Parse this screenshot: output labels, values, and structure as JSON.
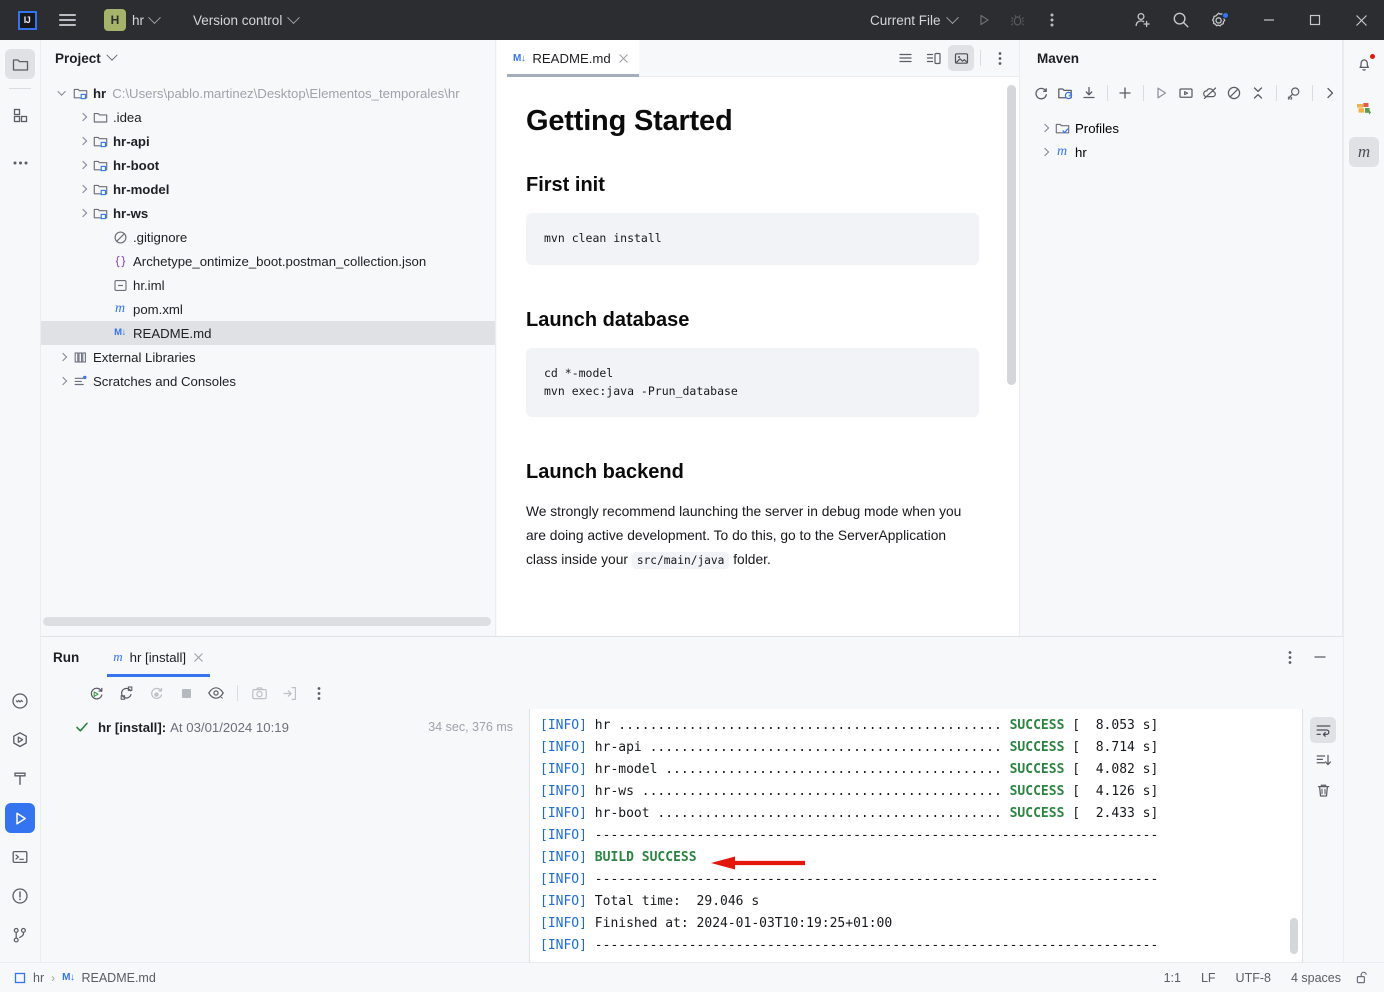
{
  "titlebar": {
    "app_logo": "intellij-idea-logo",
    "logo_text": "IJ",
    "menu_icon": "hamburger-menu-icon",
    "project_badge": "H",
    "project_name": "hr",
    "version_control": "Version control",
    "run_config": "Current File",
    "run_icon": "run-icon",
    "debug_icon": "debug-icon",
    "more_icon": "more-actions-icon",
    "share_icon": "add-user-icon",
    "search_icon": "search-icon",
    "settings_icon": "settings-gear-icon",
    "minimize": "minimize-icon",
    "maximize": "maximize-icon",
    "close": "close-icon"
  },
  "left_toolbar": [
    {
      "name": "project-tool-window",
      "icon": "folder-icon",
      "selected": true
    },
    {
      "name": "structure-tool-window",
      "icon": "modules-icon",
      "selected": false
    },
    {
      "name": "more-tool-windows",
      "icon": "ellipsis-icon",
      "selected": false
    }
  ],
  "left_toolbar_bottom": [
    {
      "name": "commit-tool-window",
      "icon": "commit-icon",
      "selected": false
    },
    {
      "name": "services-tool-window",
      "icon": "services-icon",
      "selected": false
    },
    {
      "name": "build-tool-window",
      "icon": "hammer-icon",
      "selected": false
    },
    {
      "name": "run-tool-window",
      "icon": "run-play-icon",
      "selected": true
    },
    {
      "name": "terminal-tool-window",
      "icon": "terminal-icon",
      "selected": false
    },
    {
      "name": "problems-tool-window",
      "icon": "warning-circle-icon",
      "selected": false
    },
    {
      "name": "git-tool-window",
      "icon": "git-branch-icon",
      "selected": false
    }
  ],
  "right_toolbar": [
    {
      "name": "notifications",
      "icon": "bell-icon",
      "badge": true
    },
    {
      "name": "database-tool-window",
      "icon": "database-icon",
      "badge": false
    },
    {
      "name": "maven-tool-window",
      "icon": "maven-m-icon",
      "selected": true
    }
  ],
  "project_panel": {
    "title": "Project",
    "tree": [
      {
        "label": "hr",
        "path": "C:\\Users\\pablo.martinez\\Desktop\\Elementos_temporales\\hr",
        "icon": "module-folder-icon",
        "indent": 0,
        "twisty": "down",
        "bold": true
      },
      {
        "label": ".idea",
        "icon": "folder-icon",
        "indent": 1,
        "twisty": "right",
        "bold": false
      },
      {
        "label": "hr-api",
        "icon": "module-folder-icon",
        "indent": 1,
        "twisty": "right",
        "bold": true
      },
      {
        "label": "hr-boot",
        "icon": "module-folder-icon",
        "indent": 1,
        "twisty": "right",
        "bold": true
      },
      {
        "label": "hr-model",
        "icon": "module-folder-icon",
        "indent": 1,
        "twisty": "right",
        "bold": true
      },
      {
        "label": "hr-ws",
        "icon": "module-folder-icon",
        "indent": 1,
        "twisty": "right",
        "bold": true
      },
      {
        "label": ".gitignore",
        "icon": "gitignore-icon",
        "indent": 2,
        "twisty": "none",
        "bold": false
      },
      {
        "label": "Archetype_ontimize_boot.postman_collection.json",
        "icon": "json-icon",
        "indent": 2,
        "twisty": "none",
        "bold": false
      },
      {
        "label": "hr.iml",
        "icon": "iml-icon",
        "indent": 2,
        "twisty": "none",
        "bold": false
      },
      {
        "label": "pom.xml",
        "icon": "maven-m-icon",
        "indent": 2,
        "twisty": "none",
        "bold": false
      },
      {
        "label": "README.md",
        "icon": "markdown-icon",
        "indent": 2,
        "twisty": "none",
        "bold": false,
        "selected": true
      },
      {
        "label": "External Libraries",
        "icon": "libraries-icon",
        "indent": 0,
        "twisty": "right",
        "bold": false
      },
      {
        "label": "Scratches and Consoles",
        "icon": "scratches-icon",
        "indent": 0,
        "twisty": "right",
        "bold": false
      }
    ]
  },
  "editor": {
    "tab": {
      "label": "README.md",
      "icon": "markdown-icon",
      "close": "close-icon"
    },
    "view_buttons": [
      {
        "name": "editor-only-view",
        "icon": "lines-icon",
        "active": false
      },
      {
        "name": "editor-and-preview-view",
        "icon": "split-view-icon",
        "active": false
      },
      {
        "name": "preview-only-view",
        "icon": "image-preview-icon",
        "active": true
      }
    ],
    "more_icon": "more-options-icon",
    "markdown": {
      "h1": "Getting Started",
      "section1_title": "First init",
      "section1_code": "mvn clean install",
      "section2_title": "Launch database",
      "section2_code": "cd *-model\nmvn exec:java -Prun_database",
      "section3_title": "Launch backend",
      "section3_text_a": "We strongly recommend launching the server in debug mode when you are doing active development. To do this, go to the ServerApplication class inside your ",
      "section3_code_inline": "src/main/java",
      "section3_text_b": " folder."
    }
  },
  "maven_panel": {
    "title": "Maven",
    "toolbar": [
      {
        "name": "reload-all-maven-projects-button",
        "icon": "refresh-icon"
      },
      {
        "name": "generate-sources-button",
        "icon": "folder-refresh-icon"
      },
      {
        "name": "download-sources-button",
        "icon": "download-icon"
      },
      {
        "name": "add-maven-project-button",
        "icon": "plus-icon"
      },
      {
        "name": "run-maven-build-button",
        "icon": "run-icon"
      },
      {
        "name": "execute-maven-goal-button",
        "icon": "terminal-run-icon"
      },
      {
        "name": "toggle-offline-mode-button",
        "icon": "offline-cloud-icon"
      },
      {
        "name": "toggle-skip-tests-button",
        "icon": "skip-tests-icon"
      },
      {
        "name": "collapse-all-button",
        "icon": "collapse-icon"
      },
      {
        "name": "show-dependencies-button",
        "icon": "analyze-dependencies-icon"
      },
      {
        "name": "expand-toolbar-button",
        "icon": "chevron-right-icon"
      }
    ],
    "tree": [
      {
        "label": "Profiles",
        "icon": "profiles-folder-icon",
        "twisty": "right"
      },
      {
        "label": "hr",
        "icon": "maven-m-icon",
        "twisty": "right"
      }
    ]
  },
  "run_panel": {
    "title": "Run",
    "tab": {
      "label": "hr [install]",
      "icon": "maven-m-icon",
      "close": "close-icon"
    },
    "options_icon": "more-options-icon",
    "minimize_icon": "minimize-panel-icon",
    "toolbar": [
      {
        "name": "rerun-button",
        "icon": "rerun-icon"
      },
      {
        "name": "rerun-failed-button",
        "icon": "rerun-failed-icon"
      },
      {
        "name": "rerun-automatically-button",
        "icon": "rerun-auto-icon"
      },
      {
        "name": "stop-button",
        "icon": "stop-square-icon"
      },
      {
        "name": "show-passed-button",
        "icon": "eye-icon"
      },
      {
        "name": "export-snapshot-button",
        "icon": "camera-icon"
      },
      {
        "name": "import-results-button",
        "icon": "import-icon"
      },
      {
        "name": "more-run-options",
        "icon": "more-options-icon"
      }
    ],
    "result_item": {
      "status_icon": "checkmark-icon",
      "name": "hr [install]:",
      "timestamp": "At 03/01/2024 10:19",
      "duration": "34 sec, 376 ms"
    },
    "console_gutter": [
      {
        "name": "soft-wrap-button",
        "icon": "soft-wrap-icon",
        "active": true
      },
      {
        "name": "scroll-to-end-button",
        "icon": "scroll-to-end-icon",
        "active": false
      },
      {
        "name": "clear-all-button",
        "icon": "trash-icon",
        "active": false
      }
    ],
    "console_lines": [
      {
        "prefix": "[INFO]",
        "text": " hr ................................................. ",
        "status": "SUCCESS",
        "time": "[  8.053 s]"
      },
      {
        "prefix": "[INFO]",
        "text": " hr-api ............................................. ",
        "status": "SUCCESS",
        "time": "[  8.714 s]"
      },
      {
        "prefix": "[INFO]",
        "text": " hr-model ........................................... ",
        "status": "SUCCESS",
        "time": "[  4.082 s]"
      },
      {
        "prefix": "[INFO]",
        "text": " hr-ws .............................................. ",
        "status": "SUCCESS",
        "time": "[  4.126 s]"
      },
      {
        "prefix": "[INFO]",
        "text": " hr-boot ............................................ ",
        "status": "SUCCESS",
        "time": "[  2.433 s]"
      },
      {
        "prefix": "[INFO]",
        "text": " ------------------------------------------------------------------------",
        "status": "",
        "time": ""
      },
      {
        "prefix": "[INFO]",
        "text": " ",
        "status": "BUILD SUCCESS",
        "time": ""
      },
      {
        "prefix": "[INFO]",
        "text": " ------------------------------------------------------------------------",
        "status": "",
        "time": ""
      },
      {
        "prefix": "[INFO]",
        "text": " Total time:  29.046 s",
        "status": "",
        "time": ""
      },
      {
        "prefix": "[INFO]",
        "text": " Finished at: 2024-01-03T10:19:25+01:00",
        "status": "",
        "time": ""
      },
      {
        "prefix": "[INFO]",
        "text": " ------------------------------------------------------------------------",
        "status": "",
        "time": ""
      }
    ],
    "annotation": {
      "type": "red-arrow",
      "color": "#e3170a",
      "points_to": "BUILD SUCCESS"
    }
  },
  "statusbar": {
    "breadcrumb_project": "hr",
    "breadcrumb_file": "README.md",
    "caret_position": "1:1",
    "line_separator": "LF",
    "encoding": "UTF-8",
    "indent": "4 spaces",
    "lock_icon": "unlocked-padlock-icon"
  },
  "colors": {
    "titlebar_bg": "#2b2d30",
    "accent_blue": "#3574f0",
    "success_green": "#2a8540",
    "annotation_red": "#e3170a",
    "project_badge": "#a5b46a"
  }
}
